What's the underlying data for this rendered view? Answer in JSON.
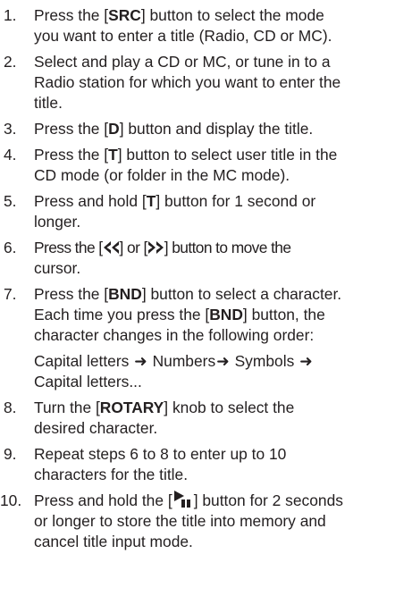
{
  "steps": [
    {
      "number": "1.",
      "parts": [
        [
          "Press the [",
          "SRC",
          "] button to select the mode"
        ],
        "you want to enter a title (Radio, CD or MC)."
      ]
    },
    {
      "number": "2.",
      "lines": [
        "Select and play a CD or MC, or tune in to a",
        "Radio station for which you want to enter the",
        "title."
      ]
    },
    {
      "number": "3.",
      "parts": [
        [
          "Press the [",
          "D",
          "] button and display the title."
        ]
      ]
    },
    {
      "number": "4.",
      "parts": [
        [
          "Press the [",
          "T",
          "] button to select user title in the"
        ],
        "CD mode (or folder in the MC mode)."
      ]
    },
    {
      "number": "5.",
      "parts": [
        [
          "Press and hold [",
          "T",
          "] button for 1 second or"
        ],
        "longer."
      ]
    },
    {
      "number": "6.",
      "pre": "Press the [",
      "mid": "] or [",
      "post": "] button to move the",
      "line2": "cursor.",
      "left_icon": "rewind-chevron-icon",
      "right_icon": "forward-chevron-icon"
    },
    {
      "number": "7.",
      "parts": [
        [
          "Press the [",
          "BND",
          "] button to select a character."
        ],
        [
          "Each time you press the [",
          "BND",
          "] button, the"
        ],
        "character changes in the following order:"
      ],
      "order": {
        "items": [
          "Capital letters",
          "Numbers",
          "Symbols",
          "Capital letters..."
        ],
        "arrow": "➜"
      }
    },
    {
      "number": "8.",
      "parts": [
        [
          "Turn the [",
          "ROTARY",
          "] knob to select the"
        ],
        "desired character."
      ]
    },
    {
      "number": "9.",
      "lines": [
        "Repeat steps 6 to 8 to enter up to 10",
        "characters for the title."
      ]
    },
    {
      "number": "10.",
      "pre": "Press and hold the [",
      "post": "] button for 2 seconds",
      "icon": "play-pause-icon",
      "lines": [
        "or longer to store the title into memory and",
        "cancel title input mode."
      ]
    }
  ]
}
